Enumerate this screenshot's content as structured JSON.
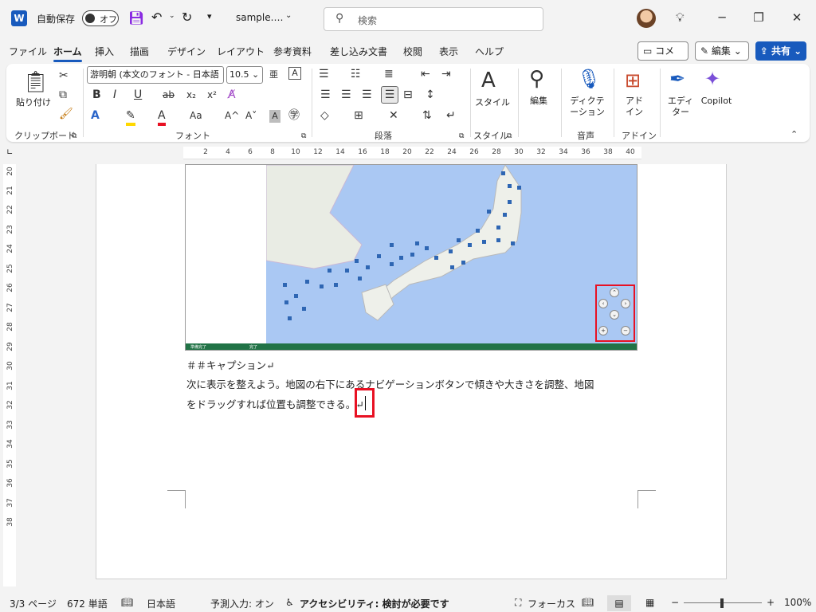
{
  "titlebar": {
    "autosave_label": "自動保存",
    "autosave_state": "オフ",
    "doc_name": "sample.…",
    "search_placeholder": "検索"
  },
  "menu_tabs": [
    "ファイル",
    "ホーム",
    "挿入",
    "描画",
    "デザイン",
    "レイアウト",
    "参考資料",
    "差し込み文書",
    "校閲",
    "表示",
    "ヘルプ"
  ],
  "active_tab": "ホーム",
  "top_buttons": {
    "comment": "コメント",
    "edit": "編集",
    "share": "共有"
  },
  "ribbon": {
    "clipboard": {
      "paste": "貼り付け",
      "group": "クリップボード"
    },
    "font": {
      "font_name": "游明朝 (本文のフォント - 日本語",
      "font_size": "10.5",
      "bold": "B",
      "italic": "I",
      "underline": "U",
      "strike": "ab",
      "subscript": "x₂",
      "superscript": "x²",
      "aa": "Aa",
      "grow": "A^",
      "shrink": "A˅",
      "group": "フォント"
    },
    "paragraph": {
      "group": "段落"
    },
    "styles": {
      "label": "スタイル",
      "group": "スタイル"
    },
    "editing": {
      "label": "編集"
    },
    "voice": {
      "label": "ディクテーション",
      "group": "音声"
    },
    "addins": {
      "label": "アドイン",
      "group": "アドイン"
    },
    "editor": {
      "label": "エディター"
    },
    "copilot": {
      "label": "Copilot"
    }
  },
  "ruler_ticks": [
    "2",
    "4",
    "6",
    "8",
    "10",
    "12",
    "14",
    "16",
    "18",
    "20",
    "22",
    "24",
    "26",
    "28",
    "30",
    "32",
    "34",
    "36",
    "38",
    "40"
  ],
  "vruler_ticks": [
    "20",
    "21",
    "22",
    "23",
    "24",
    "25",
    "26",
    "27",
    "28",
    "29",
    "30",
    "31",
    "32",
    "33",
    "34",
    "35",
    "36",
    "37",
    "38"
  ],
  "map": {
    "status_left": "準備完了",
    "status_mid": "完了"
  },
  "document": {
    "caption": "＃＃キャプション↵",
    "line1": "次に表示を整えよう。地図の右下にあるナビゲーションボタンで傾きや大きさを調整、地図",
    "line2": "をドラッグすれば位置も調整できる。↵"
  },
  "statusbar": {
    "page": "3/3 ページ",
    "words": "672 単語",
    "language": "日本語",
    "predict": "予測入力: オン",
    "accessibility": "アクセシビリティ: 検討が必要です",
    "focus": "フォーカス",
    "zoom": "100%"
  },
  "colors": {
    "accent": "#185abd",
    "highlight_red": "#e81123",
    "excel_green": "#217346"
  }
}
